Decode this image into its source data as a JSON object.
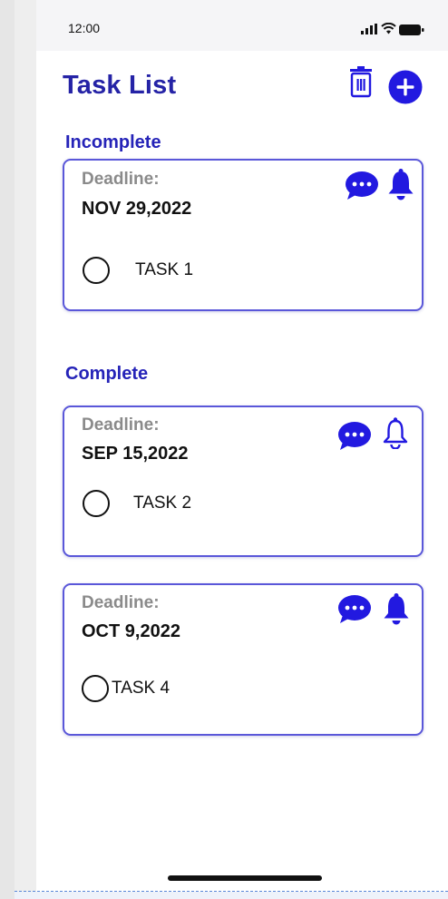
{
  "status_bar": {
    "time": "12:00",
    "icons": [
      "signal-icon",
      "wifi-icon",
      "battery-icon"
    ]
  },
  "header": {
    "title": "Task List",
    "actions": [
      {
        "name": "delete",
        "icon": "trash-icon"
      },
      {
        "name": "add",
        "icon": "plus-circle-icon"
      }
    ]
  },
  "sections": [
    {
      "title": "Incomplete",
      "tasks": [
        {
          "deadline_label": "Deadline:",
          "date": "NOV 29,2022",
          "task": "TASK 1",
          "bell": "filled"
        }
      ]
    },
    {
      "title": "Complete",
      "tasks": [
        {
          "deadline_label": "Deadline:",
          "date": "SEP 15,2022",
          "task": "TASK 2",
          "bell": "outline"
        },
        {
          "deadline_label": "Deadline:",
          "date": "OCT 9,2022",
          "task": "TASK 4",
          "bell": "filled"
        }
      ]
    }
  ],
  "colors": {
    "accent": "#2523a6",
    "card_border": "#5a57d9",
    "icon_blue": "#2219e0",
    "muted_label": "#8a8a8a"
  }
}
